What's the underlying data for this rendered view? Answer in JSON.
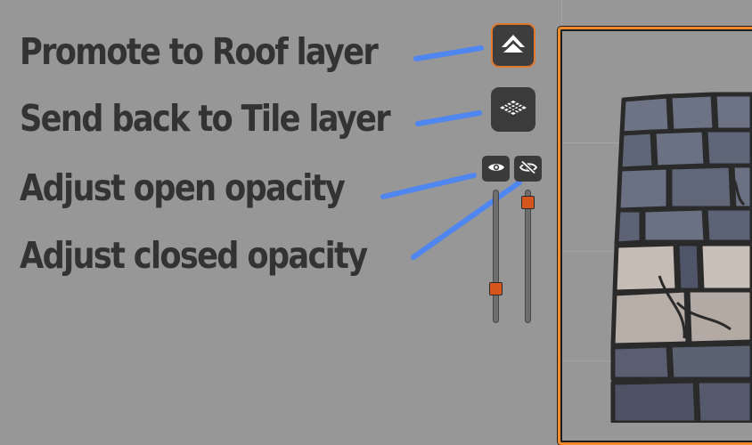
{
  "labels": {
    "promote": "Promote to Roof layer",
    "send_back": "Send back to Tile layer",
    "open_opacity": "Adjust open opacity",
    "closed_opacity": "Adjust closed opacity"
  },
  "buttons": {
    "promote_icon": "roof-icon",
    "send_back_icon": "tile-layer-icon",
    "open_icon": "eye-icon",
    "closed_icon": "eye-slash-icon"
  },
  "sliders": {
    "open_opacity_level": 0.23,
    "closed_opacity_level": 0.95
  },
  "colors": {
    "background": "#979797",
    "label_text": "#333333",
    "callout_line": "#4f86f0",
    "accent": "#e0782d",
    "slider_thumb": "#d5561c",
    "stone": "#6a7182",
    "stone_light": "#c9bfb8"
  }
}
